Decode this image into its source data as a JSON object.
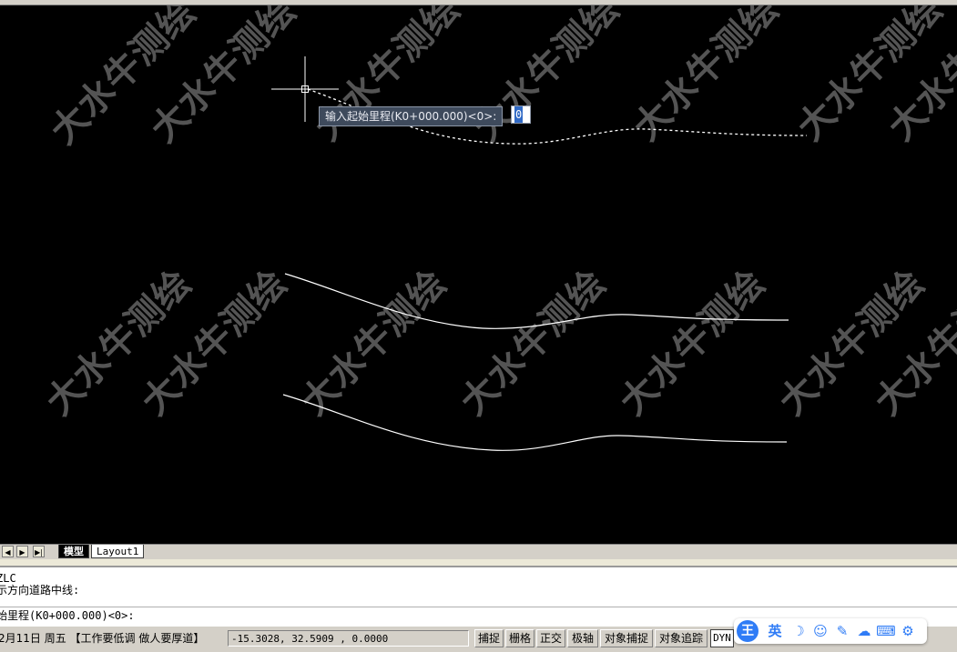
{
  "watermark": {
    "text": "大水牛测绘"
  },
  "dynamic_prompt": {
    "label": "输入起始里程(K0+000.000)<0>:",
    "value": "0"
  },
  "tabs": {
    "nav": [
      "◀",
      "▶",
      "▶|"
    ],
    "model": "模型",
    "layout1": "Layout1"
  },
  "command": {
    "lines": [
      "ZLC",
      "示方向道路中线:"
    ],
    "current": "始里程(K0+000.000)<0>:"
  },
  "status": {
    "date": "2月11日 周五 【工作要低调 做人要厚道】",
    "coords": "-15.3028,  32.5909  , 0.0000",
    "buttons": [
      "捕捉",
      "栅格",
      "正交",
      "极轴",
      "对象捕捉",
      "对象追踪"
    ],
    "dyn": "DYN"
  },
  "ime": {
    "logo": "王",
    "lang": "英",
    "icons": [
      "moon-icon",
      "smiley-icon",
      "pen-icon",
      "cloud-icon",
      "keyboard-icon",
      "gear-icon"
    ]
  },
  "colors": {
    "canvas_bg": "#000000",
    "line": "#ffffff",
    "dyn_tip_bg": "#3e4a5c",
    "ime_accent": "#2f7cf6"
  }
}
